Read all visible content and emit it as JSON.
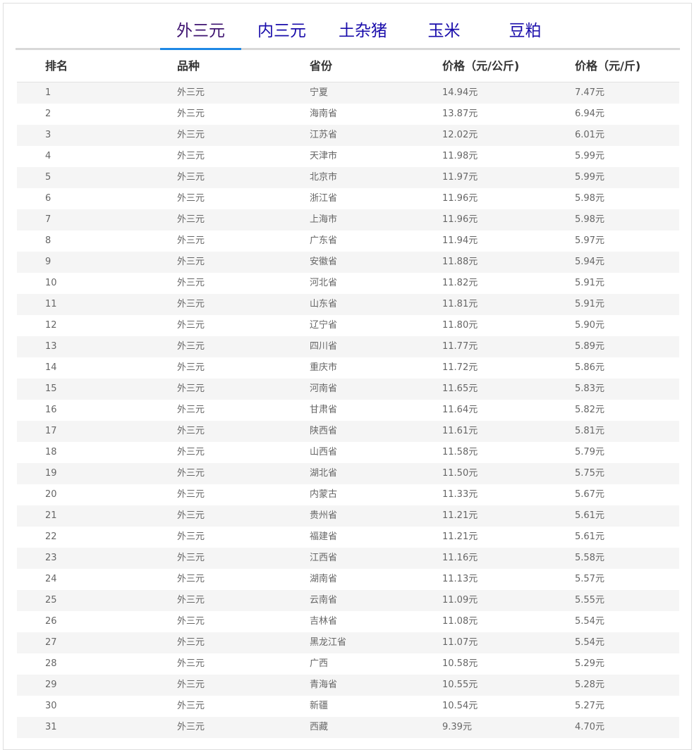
{
  "tabs": [
    {
      "label": "外三元",
      "active": true
    },
    {
      "label": "内三元",
      "active": false
    },
    {
      "label": "土杂猪",
      "active": false
    },
    {
      "label": "玉米",
      "active": false
    },
    {
      "label": "豆粕",
      "active": false
    }
  ],
  "table": {
    "headers": [
      "排名",
      "品种",
      "省份",
      "价格（元/公斤)",
      "价格（元/斤)"
    ],
    "rows": [
      [
        "1",
        "外三元",
        "宁夏",
        "14.94元",
        "7.47元"
      ],
      [
        "2",
        "外三元",
        "海南省",
        "13.87元",
        "6.94元"
      ],
      [
        "3",
        "外三元",
        "江苏省",
        "12.02元",
        "6.01元"
      ],
      [
        "4",
        "外三元",
        "天津市",
        "11.98元",
        "5.99元"
      ],
      [
        "5",
        "外三元",
        "北京市",
        "11.97元",
        "5.99元"
      ],
      [
        "6",
        "外三元",
        "浙江省",
        "11.96元",
        "5.98元"
      ],
      [
        "7",
        "外三元",
        "上海市",
        "11.96元",
        "5.98元"
      ],
      [
        "8",
        "外三元",
        "广东省",
        "11.94元",
        "5.97元"
      ],
      [
        "9",
        "外三元",
        "安徽省",
        "11.88元",
        "5.94元"
      ],
      [
        "10",
        "外三元",
        "河北省",
        "11.82元",
        "5.91元"
      ],
      [
        "11",
        "外三元",
        "山东省",
        "11.81元",
        "5.91元"
      ],
      [
        "12",
        "外三元",
        "辽宁省",
        "11.80元",
        "5.90元"
      ],
      [
        "13",
        "外三元",
        "四川省",
        "11.77元",
        "5.89元"
      ],
      [
        "14",
        "外三元",
        "重庆市",
        "11.72元",
        "5.86元"
      ],
      [
        "15",
        "外三元",
        "河南省",
        "11.65元",
        "5.83元"
      ],
      [
        "16",
        "外三元",
        "甘肃省",
        "11.64元",
        "5.82元"
      ],
      [
        "17",
        "外三元",
        "陕西省",
        "11.61元",
        "5.81元"
      ],
      [
        "18",
        "外三元",
        "山西省",
        "11.58元",
        "5.79元"
      ],
      [
        "19",
        "外三元",
        "湖北省",
        "11.50元",
        "5.75元"
      ],
      [
        "20",
        "外三元",
        "内蒙古",
        "11.33元",
        "5.67元"
      ],
      [
        "21",
        "外三元",
        "贵州省",
        "11.21元",
        "5.61元"
      ],
      [
        "22",
        "外三元",
        "福建省",
        "11.21元",
        "5.61元"
      ],
      [
        "23",
        "外三元",
        "江西省",
        "11.16元",
        "5.58元"
      ],
      [
        "24",
        "外三元",
        "湖南省",
        "11.13元",
        "5.57元"
      ],
      [
        "25",
        "外三元",
        "云南省",
        "11.09元",
        "5.55元"
      ],
      [
        "26",
        "外三元",
        "吉林省",
        "11.08元",
        "5.54元"
      ],
      [
        "27",
        "外三元",
        "黑龙江省",
        "11.07元",
        "5.54元"
      ],
      [
        "28",
        "外三元",
        "广西",
        "10.58元",
        "5.29元"
      ],
      [
        "29",
        "外三元",
        "青海省",
        "10.55元",
        "5.28元"
      ],
      [
        "30",
        "外三元",
        "新疆",
        "10.54元",
        "5.27元"
      ],
      [
        "31",
        "外三元",
        "西藏",
        "9.39元",
        "4.70元"
      ]
    ]
  }
}
